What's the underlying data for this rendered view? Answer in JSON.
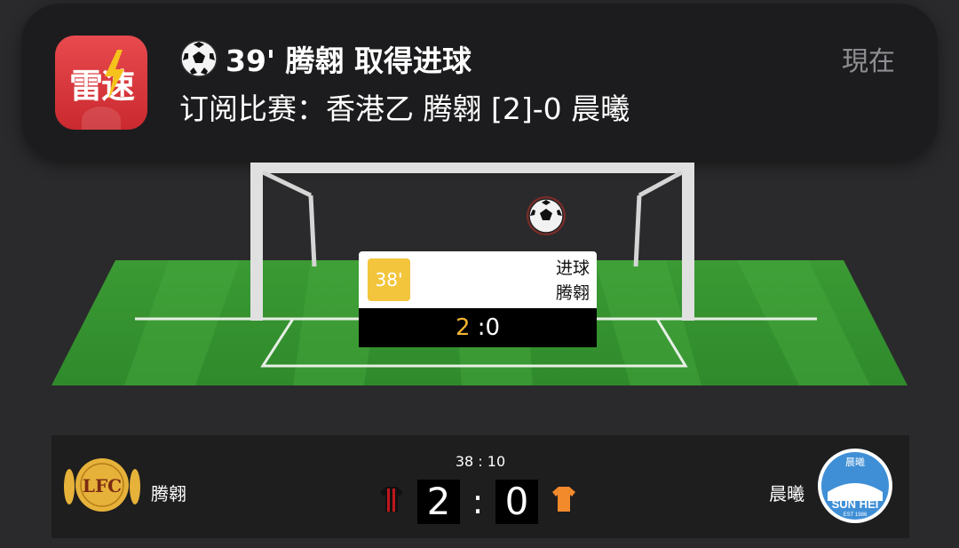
{
  "notification": {
    "app_icon_text": "雷速",
    "title": "39' 腾翱 取得进球",
    "body": "订阅比赛：香港乙 腾翱 [2]-0 晨曦",
    "time": "現在"
  },
  "event": {
    "minute": "38'",
    "type": "进球",
    "team": "腾翱",
    "home_score": "2",
    "away_score_text": ":0"
  },
  "scoreboard": {
    "clock": "38 : 10",
    "home_team": "腾翱",
    "away_team": "晨曦",
    "home_score": "2",
    "colon": ":",
    "away_score": "0",
    "home_crest_text": "LFC",
    "away_crest_top": "晨曦",
    "away_crest_name": "SUN HEI",
    "away_crest_est": "EST 1986"
  },
  "colors": {
    "app_icon": "#d9393e",
    "minute_badge": "#f2c53d",
    "score_highlight": "#f2b531",
    "home_kit": "#c0161d",
    "away_kit": "#f28a2c",
    "pitch": "#3aa33a",
    "home_crest": "#e6b23a",
    "away_crest": "#3f8fd6"
  }
}
